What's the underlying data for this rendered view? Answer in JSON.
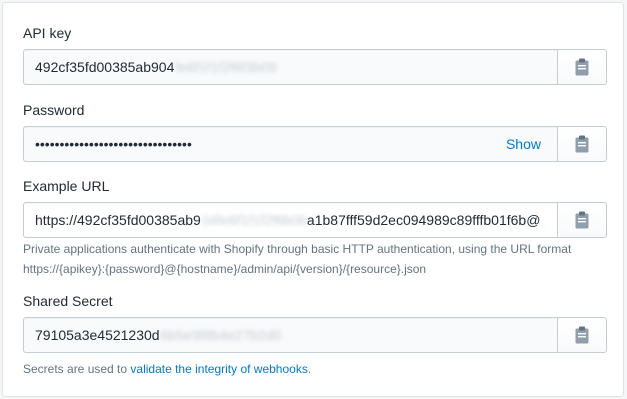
{
  "api_key": {
    "label": "API key",
    "value_visible": "492cf35fd00385ab904",
    "value_blurred": "fe6f1f1f2f6f3b09"
  },
  "password": {
    "label": "Password",
    "value_masked": "••••••••••••••••••••••••••••••••",
    "show_label": "Show"
  },
  "example_url": {
    "label": "Example URL",
    "value_prefix": "https://492cf35fd00385ab9",
    "value_blurred": "04fe6f1f1f2f6b0b",
    "value_suffix": "a1b87fff59d2ec094989c89fffb01f6b@",
    "help_line1": "Private applications authenticate with Shopify through basic HTTP authentication, using the URL format",
    "help_line2": "https://{apikey}:{password}@{hostname}/admin/api/{version}/{resource}.json"
  },
  "shared_secret": {
    "label": "Shared Secret",
    "value_visible": "79105a3e4521230d",
    "value_blurred": "6b5e9f8b4e27b2d0",
    "help_prefix": "Secrets are used to ",
    "help_link": "validate the integrity of webhooks",
    "help_suffix": "."
  },
  "icons": {
    "copy": "clipboard-icon"
  },
  "colors": {
    "link": "#007ace",
    "help_text": "#637381",
    "border": "#c4cdd5"
  }
}
